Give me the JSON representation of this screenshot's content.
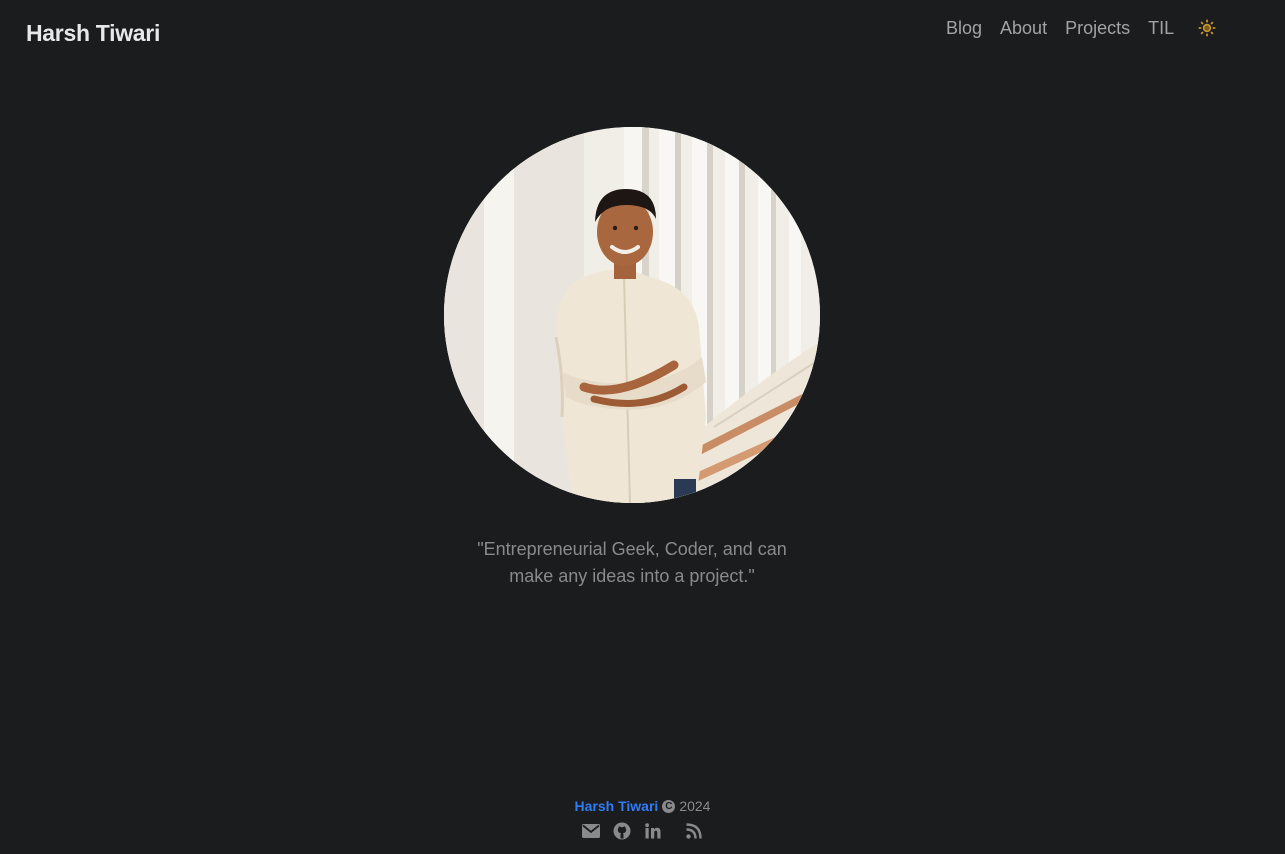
{
  "header": {
    "site_title": "Harsh Tiwari",
    "nav": [
      {
        "label": "Blog"
      },
      {
        "label": "About"
      },
      {
        "label": "Projects"
      },
      {
        "label": "TIL"
      }
    ],
    "theme_toggle_icon": "sun-icon"
  },
  "hero": {
    "avatar_icon": "profile-photo",
    "quote_line1": "\"Entrepreneurial Geek, Coder, and can",
    "quote_line2": "make any ideas into a project.\""
  },
  "footer": {
    "owner": "Harsh Tiwari",
    "year": "2024",
    "social_icons": [
      "mail-icon",
      "github-icon",
      "linkedin-icon",
      "rss-icon"
    ]
  },
  "colors": {
    "background": "#1b1c1e",
    "title": "#e8e8e8",
    "nav": "#a3a3a3",
    "accent": "#2f7cf6",
    "muted": "#8a8a8c",
    "sun": "#c9962b"
  }
}
